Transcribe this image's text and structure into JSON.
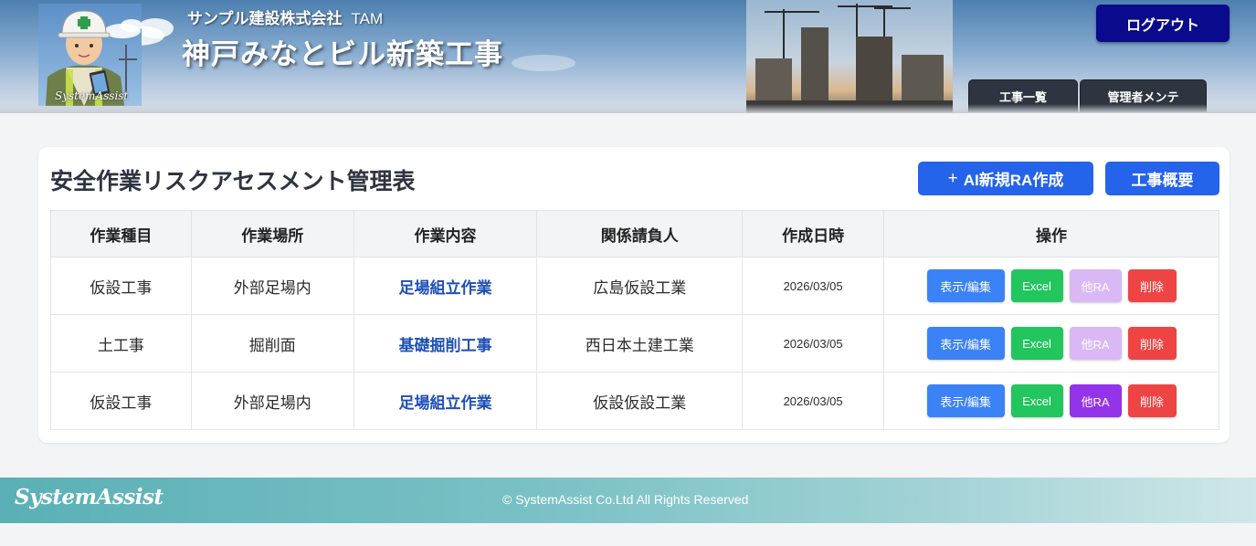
{
  "header": {
    "company_name": "サンプル建設株式会社",
    "user_name": "TAM",
    "project_title": "神戸みなとビル新築工事",
    "avatar_caption": "SystemAssist",
    "logout_label": "ログアウト",
    "tabs": [
      {
        "label": "工事一覧"
      },
      {
        "label": "管理者メンテ"
      }
    ]
  },
  "main": {
    "title": "安全作業リスクアセスメント管理表",
    "new_ra_label": "AI新規RA作成",
    "overview_label": "工事概要",
    "table": {
      "columns": [
        "作業種目",
        "作業場所",
        "作業内容",
        "関係請負人",
        "作成日時",
        "操作"
      ],
      "rows": [
        {
          "category": "仮設工事",
          "location": "外部足場内",
          "work": "足場組立作業",
          "contractor": "広島仮設工業",
          "date": "2026/03/05",
          "other_enabled": false
        },
        {
          "category": "土工事",
          "location": "掘削面",
          "work": "基礎掘削工事",
          "contractor": "西日本土建工業",
          "date": "2026/03/05",
          "other_enabled": false
        },
        {
          "category": "仮設工事",
          "location": "外部足場内",
          "work": "足場組立作業",
          "contractor": "仮設仮設工業",
          "date": "2026/03/05",
          "other_enabled": true
        }
      ],
      "actions": {
        "edit": "表示/編集",
        "excel": "Excel",
        "other": "他RA",
        "delete": "削除"
      }
    }
  },
  "footer": {
    "logo": "SystemAssist",
    "copyright": "© SystemAssist Co.Ltd All Rights Reserved"
  },
  "colors": {
    "primary": "#2563eb",
    "logout": "#0a0a8c",
    "tab": "#2f3540",
    "edit": "#3b82f6",
    "excel": "#22c55e",
    "other": "#9333ea",
    "other_disabled": "#d9b8f5",
    "delete": "#ef4444",
    "link": "#1e4fb5"
  }
}
